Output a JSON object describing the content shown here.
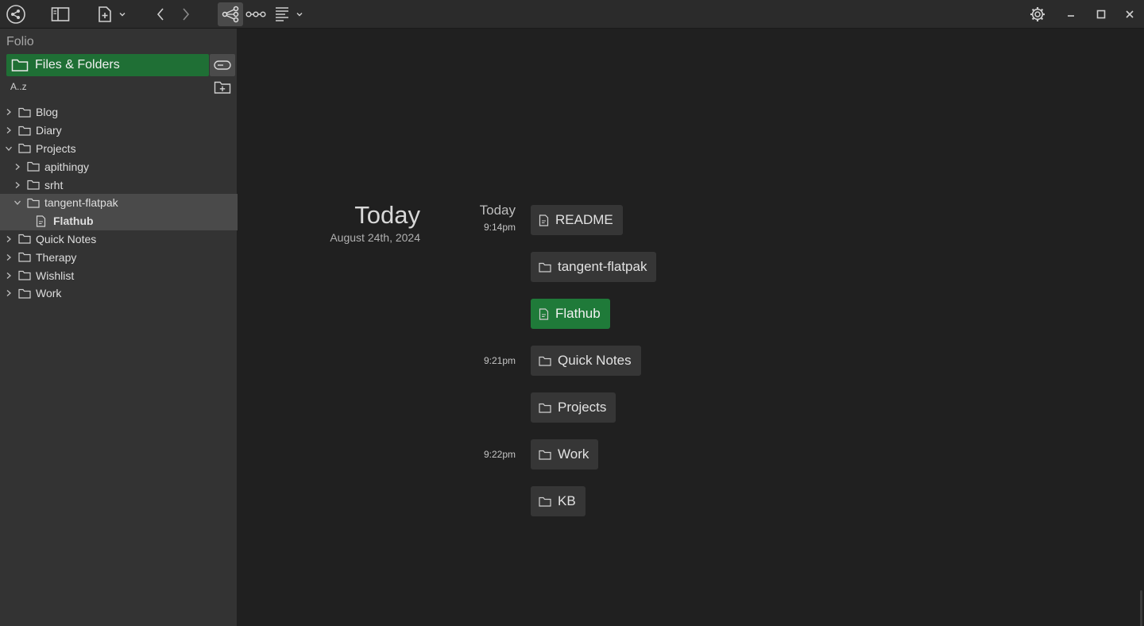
{
  "app": {
    "title": "Folio"
  },
  "sidebar": {
    "workspace_name": "Folio",
    "tab_files_label": "Files & Folders",
    "sort_label": "A..z",
    "tree": [
      {
        "label": "Blog",
        "type": "folder",
        "expanded": false,
        "depth": 0
      },
      {
        "label": "Diary",
        "type": "folder",
        "expanded": false,
        "depth": 0
      },
      {
        "label": "Projects",
        "type": "folder",
        "expanded": true,
        "depth": 0
      },
      {
        "label": "apithingy",
        "type": "folder",
        "expanded": false,
        "depth": 1
      },
      {
        "label": "srht",
        "type": "folder",
        "expanded": false,
        "depth": 1
      },
      {
        "label": "tangent-flatpak",
        "type": "folder",
        "expanded": true,
        "depth": 1,
        "selected": true
      },
      {
        "label": "Flathub",
        "type": "document",
        "depth": 2,
        "selected": true,
        "bold": true
      },
      {
        "label": "Quick Notes",
        "type": "folder",
        "expanded": false,
        "depth": 0
      },
      {
        "label": "Therapy",
        "type": "folder",
        "expanded": false,
        "depth": 0
      },
      {
        "label": "Wishlist",
        "type": "folder",
        "expanded": false,
        "depth": 0
      },
      {
        "label": "Work",
        "type": "folder",
        "expanded": false,
        "depth": 0
      }
    ]
  },
  "main": {
    "day_title": "Today",
    "day_date": "August 24th, 2024",
    "time_heading": "Today",
    "times": [
      {
        "label": "9:14pm"
      },
      {
        "label": "9:21pm"
      },
      {
        "label": "9:22pm"
      }
    ],
    "entries": [
      {
        "label": "README",
        "type": "document",
        "highlighted": false
      },
      {
        "label": "tangent-flatpak",
        "type": "folder",
        "highlighted": false
      },
      {
        "label": "Flathub",
        "type": "document",
        "highlighted": true
      },
      {
        "label": "Quick Notes",
        "type": "folder",
        "highlighted": false
      },
      {
        "label": "Projects",
        "type": "folder",
        "highlighted": false
      },
      {
        "label": "Work",
        "type": "folder",
        "highlighted": false
      },
      {
        "label": "KB",
        "type": "folder",
        "highlighted": false
      }
    ]
  },
  "toolbar": {
    "icons": [
      "app-logo-icon",
      "sidebar-toggle-icon",
      "new-document-icon",
      "chevron-down-icon",
      "back-icon",
      "forward-icon",
      "graph-view-icon",
      "link-chain-icon",
      "text-format-icon",
      "chevron-down-icon",
      "settings-gear-icon",
      "minimize-icon",
      "maximize-icon",
      "close-icon"
    ]
  },
  "colors": {
    "accent": "#1f7a39",
    "sidebar_bg": "#333333",
    "main_bg": "#202020",
    "toolbar_bg": "#2b2b2b"
  }
}
